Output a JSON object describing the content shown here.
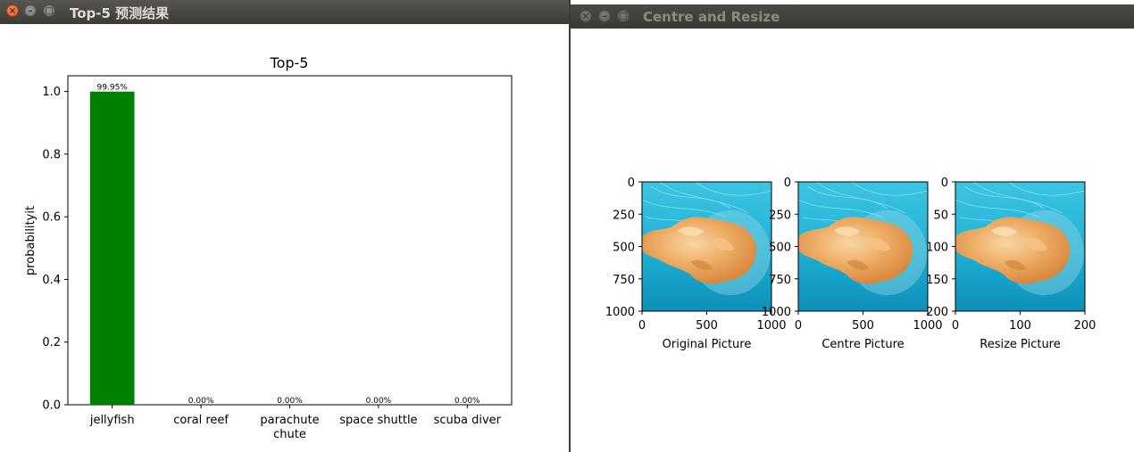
{
  "window_left": {
    "title": "Top-5 预测结果",
    "buttons": {
      "close": "×",
      "minimize": "–",
      "maximize": "□"
    }
  },
  "window_right": {
    "title": "Centre and Resize",
    "buttons": {
      "close": "×",
      "minimize": "–",
      "maximize": "□"
    }
  },
  "chart_data": [
    {
      "type": "bar",
      "title": "Top-5",
      "xlabel": "",
      "ylabel": "probabilityit",
      "categories": [
        "jellyfish",
        "coral reef",
        "parachute chute",
        "space shuttle",
        "scuba diver"
      ],
      "category_lines": [
        [
          "jellyfish"
        ],
        [
          "coral reef"
        ],
        [
          "parachute",
          "chute"
        ],
        [
          "space shuttle"
        ],
        [
          "scuba diver"
        ]
      ],
      "values": [
        0.9995,
        0.0,
        0.0,
        0.0,
        0.0
      ],
      "bar_labels": [
        "99.95%",
        "0.00%",
        "0.00%",
        "0.00%",
        "0.00%"
      ],
      "ylim": [
        0,
        1.05
      ],
      "yticks": [
        0.0,
        0.2,
        0.4,
        0.6,
        0.8,
        1.0
      ],
      "ytick_labels": [
        "0.0",
        "0.2",
        "0.4",
        "0.6",
        "0.8",
        "1.0"
      ],
      "bar_color": "#008000",
      "grid": false
    },
    {
      "type": "image",
      "caption": "Original Picture",
      "xticks": [
        "0",
        "500",
        "1000"
      ],
      "yticks": [
        "0",
        "250",
        "500",
        "750",
        "1000"
      ]
    },
    {
      "type": "image",
      "caption": "Centre Picture",
      "xticks": [
        "0",
        "500",
        "1000"
      ],
      "yticks": [
        "0",
        "250",
        "500",
        "750",
        "1000"
      ]
    },
    {
      "type": "image",
      "caption": "Resize Picture",
      "xticks": [
        "0",
        "100",
        "200"
      ],
      "yticks": [
        "0",
        "50",
        "100",
        "150",
        "200"
      ]
    }
  ],
  "colors": {
    "water": "#1fb3d6",
    "water_dark": "#0e8fb8",
    "jelly": "#e9a25a",
    "jelly_light": "#f6cf98"
  }
}
